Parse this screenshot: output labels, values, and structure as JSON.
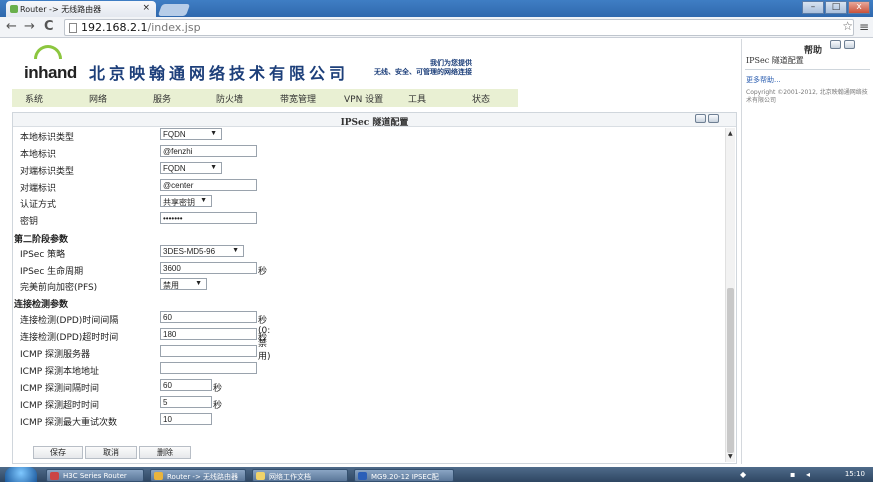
{
  "browser": {
    "tab_title": "Router -> 无线路由器",
    "tab_close": "×",
    "url_host": "192.168.2.1",
    "url_path": "/index.jsp",
    "back": "←",
    "forward": "→",
    "reload": "C",
    "star": "☆",
    "menu": "≡",
    "win_min": "–",
    "win_max": "□",
    "win_close": "x"
  },
  "header": {
    "logo_text": "inhand",
    "company": "北京映翰通网络技术有限公司",
    "slogan_line1": "我们为您提供",
    "slogan_line2": "无线、安全、可管理的网络连接"
  },
  "nav": {
    "items": [
      "系统",
      "网络",
      "服务",
      "防火墙",
      "带宽管理",
      "VPN 设置",
      "工具",
      "状态"
    ]
  },
  "panel": {
    "title": "IPSec 隧道配置",
    "fields": {
      "local_id_type": {
        "label": "本地标识类型",
        "value": "FQDN"
      },
      "local_id": {
        "label": "本地标识",
        "value": "@fenzhi"
      },
      "remote_id_type": {
        "label": "对端标识类型",
        "value": "FQDN"
      },
      "remote_id": {
        "label": "对端标识",
        "value": "@center"
      },
      "auth_method": {
        "label": "认证方式",
        "value": "共享密钥"
      },
      "key": {
        "label": "密钥",
        "value": "•••••••"
      }
    },
    "phase2": {
      "title": "第二阶段参数",
      "policy": {
        "label": "IPSec 策略",
        "value": "3DES-MD5-96"
      },
      "lifetime": {
        "label": "IPSec 生命周期",
        "value": "3600",
        "unit": "秒"
      },
      "pfs": {
        "label": "完美前向加密(PFS)",
        "value": "禁用"
      }
    },
    "dpd": {
      "title": "连接检测参数",
      "interval": {
        "label": "连接检测(DPD)时间间隔",
        "value": "60",
        "unit": "秒(0: 禁用)"
      },
      "timeout": {
        "label": "连接检测(DPD)超时时间",
        "value": "180",
        "unit": "秒"
      },
      "icmp_server": {
        "label": "ICMP 探测服务器",
        "value": ""
      },
      "icmp_local": {
        "label": "ICMP 探测本地地址",
        "value": ""
      },
      "icmp_interval": {
        "label": "ICMP 探测间隔时间",
        "value": "60",
        "unit": "秒"
      },
      "icmp_timeout": {
        "label": "ICMP 探测超时时间",
        "value": "5",
        "unit": "秒"
      },
      "icmp_retries": {
        "label": "ICMP 探测最大重试次数",
        "value": "10"
      }
    },
    "buttons": {
      "save": "保存",
      "cancel": "取消",
      "delete": "删除"
    }
  },
  "help": {
    "title": "帮助",
    "subtitle": "IPSec 隧道配置",
    "more": "更多帮助...",
    "copyright": "Copyright ©2001-2012, 北京映翰通网络技术有限公司"
  },
  "taskbar": {
    "tasks": [
      "H3C Series Router",
      "Router -> 无线路由器",
      "网络工作文档",
      "MG9.20-12 IPSEC配"
    ],
    "clock": "15:10"
  }
}
